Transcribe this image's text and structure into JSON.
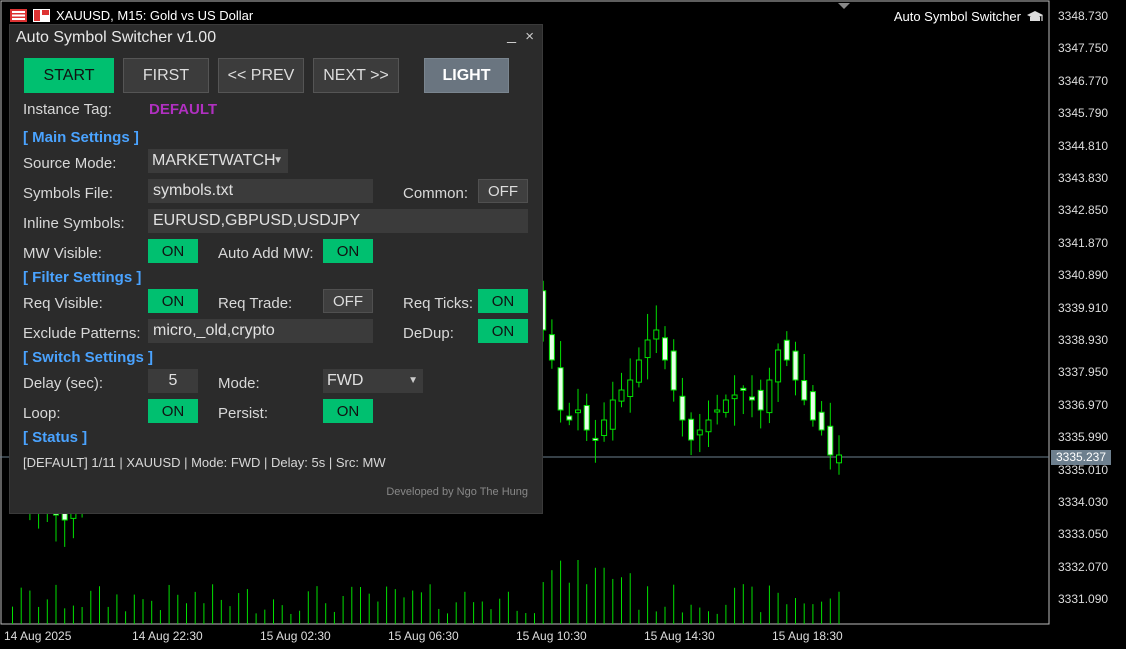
{
  "chart_header": {
    "symbol_line": "XAUUSD, M15:  Gold vs US Dollar",
    "ea_name": "Auto Symbol Switcher"
  },
  "price_axis": [
    "3348.730",
    "3347.750",
    "3346.770",
    "3345.790",
    "3344.810",
    "3343.830",
    "3342.850",
    "3341.870",
    "3340.890",
    "3339.910",
    "3338.930",
    "3337.950",
    "3336.970",
    "3335.990",
    "3335.010",
    "3334.030",
    "3333.050",
    "3332.070",
    "3331.090"
  ],
  "current_price": "3335.237",
  "time_axis": [
    "14 Aug 2025",
    "14 Aug 22:30",
    "15 Aug 02:30",
    "15 Aug 06:30",
    "15 Aug 10:30",
    "15 Aug 14:30",
    "15 Aug 18:30"
  ],
  "panel": {
    "title": "Auto Symbol Switcher v1.00",
    "min_label": "_",
    "close_label": "×",
    "buttons": {
      "start": "START",
      "first": "FIRST",
      "prev": "<< PREV",
      "next": "NEXT >>",
      "theme": "LIGHT"
    },
    "instance_tag_label": "Instance Tag:",
    "instance_tag_value": "DEFAULT",
    "main_settings": "[ Main Settings ]",
    "source_mode_label": "Source Mode:",
    "source_mode_value": "MARKETWATCH",
    "symbols_file_label": "Symbols File:",
    "symbols_file_value": "symbols.txt",
    "common_label": "Common:",
    "common_value": "OFF",
    "inline_symbols_label": "Inline Symbols:",
    "inline_symbols_value": "EURUSD,GBPUSD,USDJPY",
    "mw_visible_label": "MW Visible:",
    "mw_visible_value": "ON",
    "auto_add_label": "Auto Add MW:",
    "auto_add_value": "ON",
    "filter_settings": "[ Filter Settings ]",
    "req_visible_label": "Req Visible:",
    "req_visible_value": "ON",
    "req_trade_label": "Req Trade:",
    "req_trade_value": "OFF",
    "req_ticks_label": "Req Ticks:",
    "req_ticks_value": "ON",
    "exclude_label": "Exclude Patterns:",
    "exclude_value": "micro,_old,crypto",
    "dedup_label": "DeDup:",
    "dedup_value": "ON",
    "switch_settings": "[ Switch Settings ]",
    "delay_label": "Delay (sec):",
    "delay_value": "5",
    "mode_label": "Mode:",
    "mode_value": "FWD",
    "loop_label": "Loop:",
    "loop_value": "ON",
    "persist_label": "Persist:",
    "persist_value": "ON",
    "status_section": "[ Status ]",
    "status_text": "[DEFAULT] 1/11 | XAUUSD | Mode: FWD | Delay: 5s | Src: MW",
    "credit": "Developed by Ngo The Hung"
  },
  "colors": {
    "candle": "#00e000",
    "on": "#00c070",
    "accent": "#4aa3ff",
    "tag": "#b030c0",
    "start": "#00c070"
  }
}
